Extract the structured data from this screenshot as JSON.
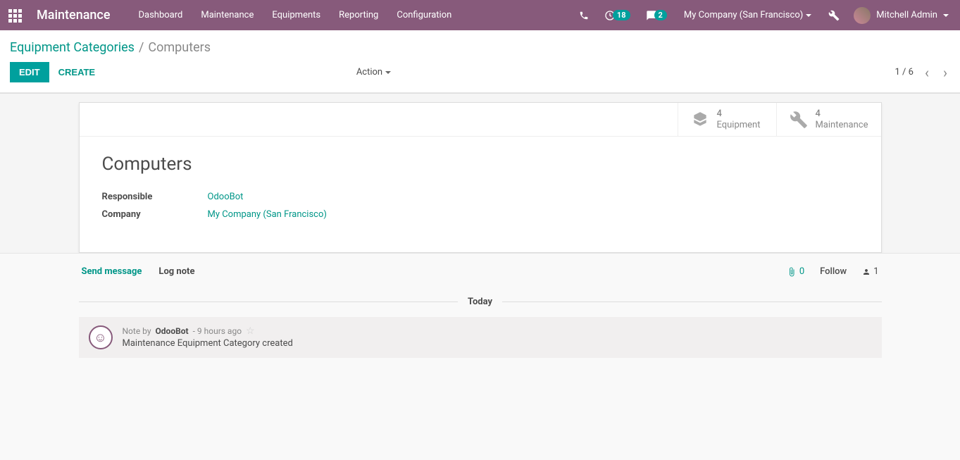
{
  "navbar": {
    "brand": "Maintenance",
    "menu": [
      "Dashboard",
      "Maintenance",
      "Equipments",
      "Reporting",
      "Configuration"
    ],
    "activities_badge": "18",
    "messages_badge": "2",
    "company": "My Company (San Francisco)",
    "user": "Mitchell Admin"
  },
  "breadcrumb": {
    "parent": "Equipment Categories",
    "sep": "/",
    "active": "Computers"
  },
  "toolbar": {
    "edit": "EDIT",
    "create": "CREATE",
    "action": "Action",
    "pager": "1 / 6"
  },
  "stat": {
    "equipment_count": "4",
    "equipment_label": "Equipment",
    "maintenance_count": "4",
    "maintenance_label": "Maintenance"
  },
  "record": {
    "title": "Computers",
    "responsible_label": "Responsible",
    "responsible_value": "OdooBot",
    "company_label": "Company",
    "company_value": "My Company (San Francisco)"
  },
  "chatter": {
    "send": "Send message",
    "log": "Log note",
    "attach_count": "0",
    "follow": "Follow",
    "followers_count": "1",
    "separator": "Today"
  },
  "message": {
    "prefix": "Note by",
    "author": "OdooBot",
    "time": "- 9 hours ago",
    "body": "Maintenance Equipment Category created"
  }
}
